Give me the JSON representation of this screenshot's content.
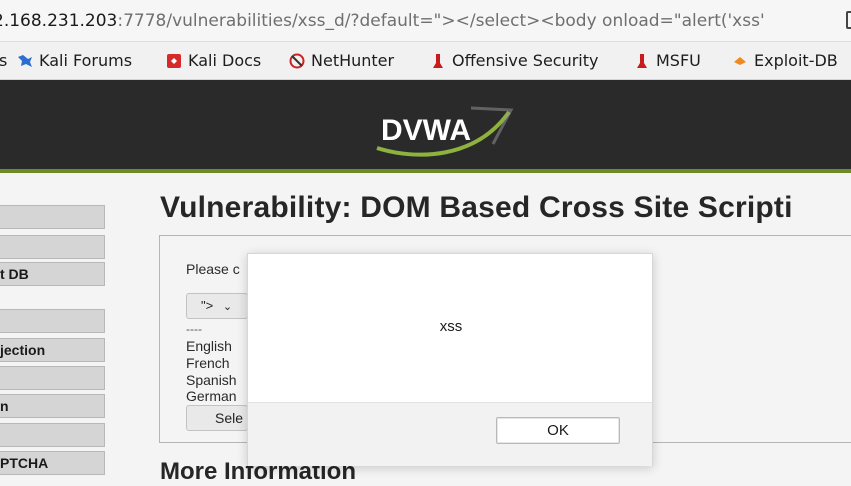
{
  "browser": {
    "url_host": "2.168.231.203",
    "url_path": ":7778/vulnerabilities/xss_d/?default=\"></select><body onload=\"alert('xss'",
    "bookmarks": [
      {
        "label": "s",
        "icon": "none"
      },
      {
        "label": "Kali Forums",
        "icon": "kali-forums-icon"
      },
      {
        "label": "Kali Docs",
        "icon": "kali-docs-icon"
      },
      {
        "label": "NetHunter",
        "icon": "nethunter-icon"
      },
      {
        "label": "Offensive Security",
        "icon": "offensive-security-icon"
      },
      {
        "label": "MSFU",
        "icon": "msfu-icon"
      },
      {
        "label": "Exploit-DB",
        "icon": "exploit-db-icon"
      }
    ]
  },
  "header": {
    "logo_text": "DVWA",
    "accent_color": "#6e8b2a"
  },
  "sidebar": {
    "items": [
      {
        "label": ""
      },
      {
        "label": ""
      },
      {
        "label": "t DB"
      },
      {
        "label": ""
      },
      {
        "label": "jection"
      },
      {
        "label": ""
      },
      {
        "label": "n"
      },
      {
        "label": ""
      },
      {
        "label": "PTCHA"
      }
    ]
  },
  "main": {
    "title": "Vulnerability: DOM Based Cross Site Scripti",
    "prompt_partial": "Please c",
    "select_value": "\">",
    "options": [
      "----",
      "English",
      "French",
      "Spanish",
      "German"
    ],
    "select_button_partial": "Sele",
    "more_info": "More Information"
  },
  "dialog": {
    "message": "xss",
    "ok_label": "OK"
  }
}
